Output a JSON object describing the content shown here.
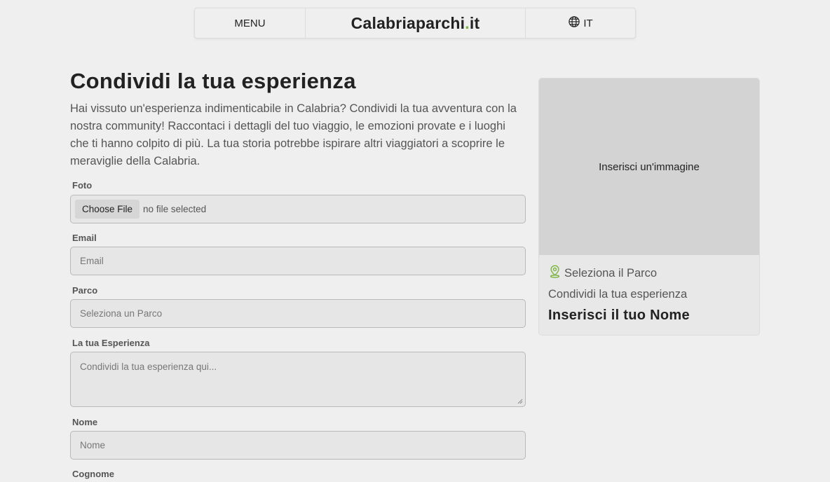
{
  "nav": {
    "menu_label": "MENU",
    "logo_main": "Calabriaparchi",
    "logo_dot": ".",
    "logo_tld": "it",
    "lang_label": "IT",
    "globe_icon": "globe-icon"
  },
  "page": {
    "title": "Condividi la tua esperienza",
    "intro": "Hai vissuto un'esperienza indimenticabile in Calabria? Condividi la tua avventura con la nostra community! Raccontaci i dettagli del tuo viaggio, le emozioni provate e i luoghi che ti hanno colpito di più. La tua storia potrebbe ispirare altri viaggiatori a scoprire le meraviglie della Calabria."
  },
  "form": {
    "foto_label": "Foto",
    "file_button": "Choose File",
    "file_status": "no file selected",
    "email_label": "Email",
    "email_placeholder": "Email",
    "parco_label": "Parco",
    "parco_placeholder": "Seleziona un Parco",
    "esperienza_label": "La tua Esperienza",
    "esperienza_placeholder": "Condividi la tua esperienza qui...",
    "nome_label": "Nome",
    "nome_placeholder": "Nome",
    "cognome_label": "Cognome"
  },
  "preview": {
    "image_prompt": "Inserisci un'immagine",
    "park_icon": "map-pin-icon",
    "park_text": "Seleziona il Parco",
    "experience_text": "Condividi la tua esperienza",
    "name_text": "Inserisci il tuo Nome"
  },
  "colors": {
    "accent_green": "#7cb342",
    "background": "#efefef"
  }
}
